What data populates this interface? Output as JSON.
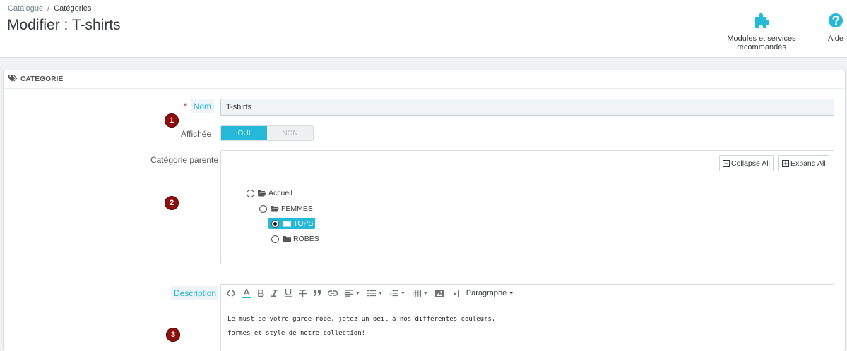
{
  "breadcrumb": {
    "parent": "Catalogue",
    "separator": "/",
    "current": "Catégories"
  },
  "page_title": "Modifier : T-shirts",
  "toolbar": {
    "modules_label": "Modules et services recommandés",
    "help_label": "Aide",
    "accent": "#25b9d7"
  },
  "panel": {
    "heading": "CATÉGORIE",
    "name": {
      "required_mark": "*",
      "label": "Nom",
      "value": "T-shirts"
    },
    "displayed": {
      "label": "Affichée",
      "on_label": "OUI",
      "off_label": "NON",
      "selected": "OUI"
    },
    "parent": {
      "label": "Catégorie parente",
      "collapse_label": "Collapse All",
      "expand_label": "Expand All",
      "tree": [
        {
          "label": "Accueil",
          "icon": "folder-open-icon",
          "checked": false
        },
        {
          "label": "FEMMES",
          "icon": "folder-open-icon",
          "checked": false
        },
        {
          "label": "TOPS",
          "icon": "folder-icon",
          "checked": true
        },
        {
          "label": "ROBES",
          "icon": "folder-icon",
          "checked": false
        }
      ]
    },
    "description": {
      "label": "Description",
      "format_label": "Paragraphe",
      "lines": [
        "Le must de votre garde-robe, jetez un oeil à nos différentes couleurs,",
        "formes et style de notre collection!"
      ]
    }
  },
  "markers": [
    "1",
    "2",
    "3"
  ],
  "marker_color": "#8e0e0e"
}
